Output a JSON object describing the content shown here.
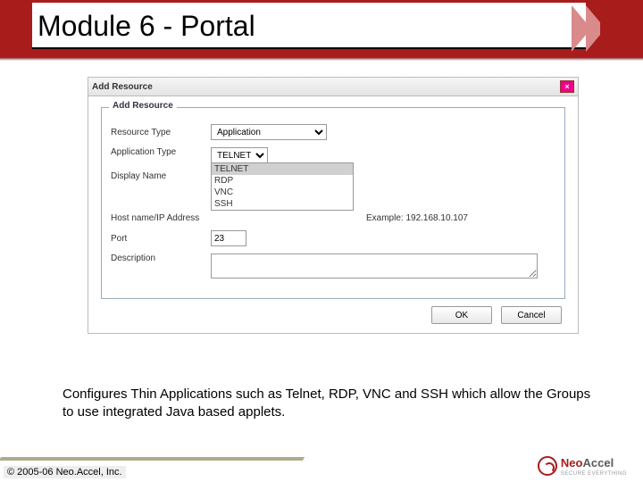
{
  "title": "Module 6 - Portal",
  "dialog": {
    "title": "Add Resource",
    "legend": "Add Resource",
    "labels": {
      "resource_type": "Resource Type",
      "application_type": "Application Type",
      "display_name": "Display Name",
      "host": "Host name/IP Address",
      "port": "Port",
      "description": "Description"
    },
    "resource_type_value": "Application",
    "application_type_value": "TELNET",
    "app_options": [
      "TELNET",
      "RDP",
      "VNC",
      "SSH"
    ],
    "port_value": "23",
    "example_text": "Example: 192.168.10.107",
    "ok_label": "OK",
    "cancel_label": "Cancel"
  },
  "caption": "Configures Thin Applications such as Telnet, RDP, VNC and SSH which allow the Groups to use integrated Java based applets.",
  "footer": {
    "copyright": "© 2005-06 Neo.Accel, Inc.",
    "logo_neo": "Neo",
    "logo_accel": "Accel",
    "logo_tagline": "SECURE EVERYTHING"
  }
}
